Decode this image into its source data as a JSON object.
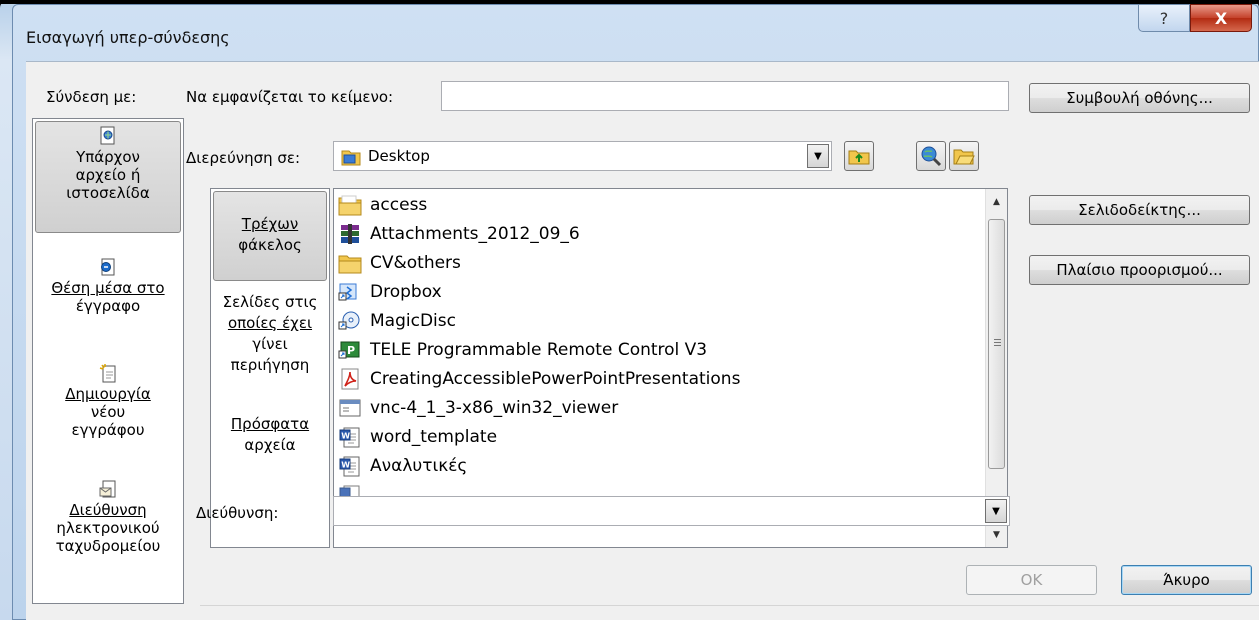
{
  "dialog": {
    "title": "Εισαγωγή υπερ-σύνδεσης",
    "help_label": "?",
    "close_label": "X"
  },
  "link_to": {
    "header": "Σύνδεση με:",
    "items": [
      {
        "l1": "Υπάρχον",
        "l2": "αρχείο ή",
        "l3": "ιστοσελίδα",
        "icon": "existing-file-icon",
        "active": true
      },
      {
        "l1": "Θέση μέσα στο",
        "l2": "έγγραφο",
        "icon": "place-in-document-icon"
      },
      {
        "l1": "Δημιουργία",
        "l2": "νέου",
        "l3": "εγγράφου",
        "icon": "new-document-icon"
      },
      {
        "l1": "Διεύθυνση",
        "l2": "ηλεκτρονικού",
        "l3": "ταχυδρομείου",
        "icon": "email-address-icon"
      }
    ]
  },
  "display_text": {
    "label": "Να εμφανίζεται το κείμενο:",
    "value": ""
  },
  "screentip_button": "Συμβουλή οθόνης...",
  "look_in": {
    "label": "Διερεύνηση σε:",
    "value": "Desktop",
    "icon": "desktop-folder-icon"
  },
  "toolbar_icons": [
    "up-one-folder-icon",
    "browse-web-icon",
    "browse-file-icon"
  ],
  "look_panel": {
    "items": [
      {
        "l1": "Τρέχων",
        "l2": "φάκελος",
        "active": true
      },
      {
        "l1": "Σελίδες στις",
        "l2": "οποίες έχει",
        "l3": "γίνει",
        "l4": "περιήγηση"
      },
      {
        "l1": "Πρόσφατα",
        "l2": "αρχεία"
      }
    ]
  },
  "files": [
    {
      "name": "access",
      "icon": "folder-icon"
    },
    {
      "name": "Attachments_2012_09_6",
      "icon": "archive-icon"
    },
    {
      "name": "CV&others",
      "icon": "folder-icon"
    },
    {
      "name": "Dropbox",
      "icon": "shortcut-icon"
    },
    {
      "name": "MagicDisc",
      "icon": "shortcut-disc-icon"
    },
    {
      "name": "TELE Programmable Remote Control V3",
      "icon": "shortcut-app-icon"
    },
    {
      "name": "CreatingAccessiblePowerPointPresentations",
      "icon": "pdf-icon"
    },
    {
      "name": "vnc-4_1_3-x86_win32_viewer",
      "icon": "exe-icon"
    },
    {
      "name": "word_template",
      "icon": "word-doc-icon"
    },
    {
      "name": "Αναλυτικές",
      "icon": "word-doc-icon"
    }
  ],
  "side_buttons": {
    "bookmark": "Σελιδοδείκτης...",
    "target_frame": "Πλαίσιο προορισμού..."
  },
  "address": {
    "label": "Διεύθυνση:",
    "value": ""
  },
  "buttons": {
    "ok": "OK",
    "cancel": "Άκυρο"
  }
}
